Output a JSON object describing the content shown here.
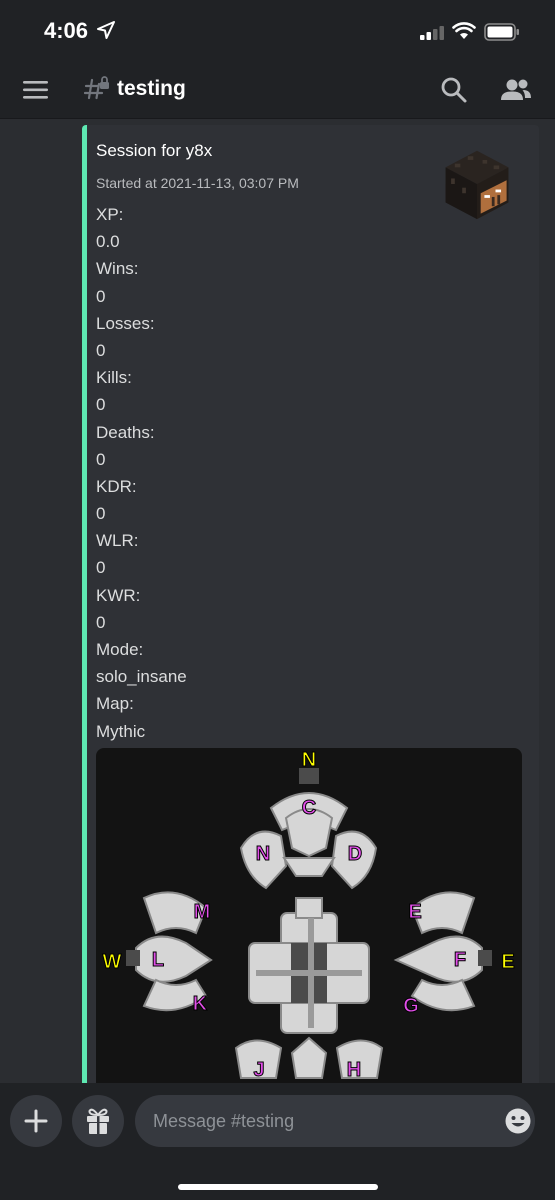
{
  "status_bar": {
    "time": "4:06"
  },
  "header": {
    "channel_name": "testing"
  },
  "embed": {
    "title": "Session for y8x",
    "subtitle": "Started at 2021-11-13, 03:07 PM",
    "accent_color": "#5ee8b2",
    "fields": [
      {
        "name": "XP:",
        "value": "0.0"
      },
      {
        "name": "Wins:",
        "value": "0"
      },
      {
        "name": "Losses:",
        "value": "0"
      },
      {
        "name": "Kills:",
        "value": "0"
      },
      {
        "name": "Deaths:",
        "value": "0"
      },
      {
        "name": "KDR:",
        "value": "0"
      },
      {
        "name": "WLR:",
        "value": "0"
      },
      {
        "name": "KWR:",
        "value": "0"
      },
      {
        "name": "Mode:",
        "value": "solo_insane"
      },
      {
        "name": "Map:",
        "value": "Mythic"
      }
    ],
    "map_labels": {
      "compass": [
        "N",
        "W",
        "E"
      ],
      "islands": [
        "C",
        "N",
        "D",
        "M",
        "L",
        "K",
        "E",
        "F",
        "G",
        "J",
        "H"
      ]
    }
  },
  "composer": {
    "placeholder": "Message #testing"
  },
  "icons": [
    "location-arrow-icon",
    "signal-icon",
    "wifi-icon",
    "battery-icon",
    "hamburger-icon",
    "locked-channel-hash-icon",
    "search-icon",
    "members-icon",
    "plus-icon",
    "gift-icon",
    "emoji-icon"
  ]
}
